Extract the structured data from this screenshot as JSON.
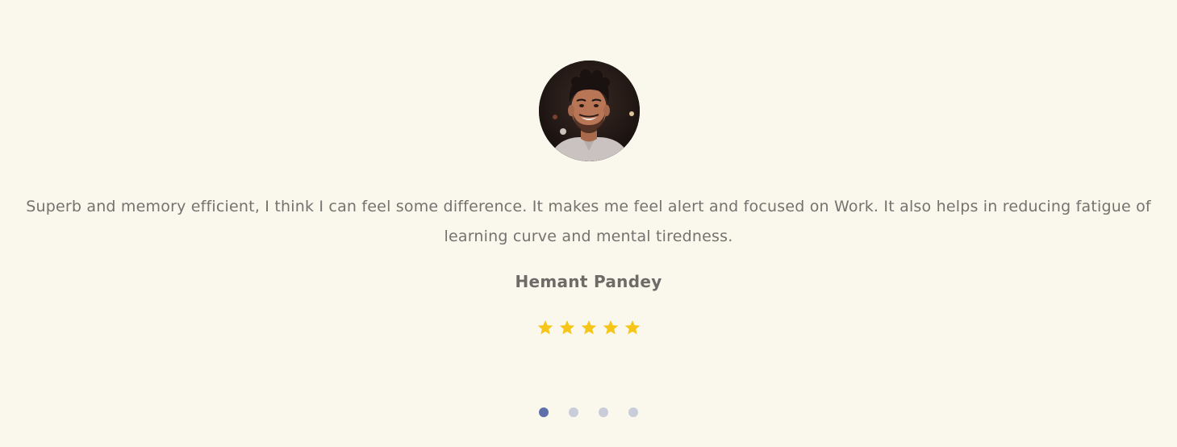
{
  "testimonial": {
    "avatar_alt": "Hemant Pandey",
    "quote": "Superb and memory efficient, I think I can feel some difference. It makes me feel alert and focused on Work. It also helps in reducing fatigue of learning curve and mental tiredness.",
    "author": "Hemant Pandey",
    "rating": 5,
    "rating_max": 5,
    "star_icon": "star-icon",
    "star_color": "#f5c518"
  },
  "carousel": {
    "slide_count": 4,
    "active_index": 0,
    "active_color": "#5f6fac",
    "inactive_color": "#c9ccd9"
  }
}
